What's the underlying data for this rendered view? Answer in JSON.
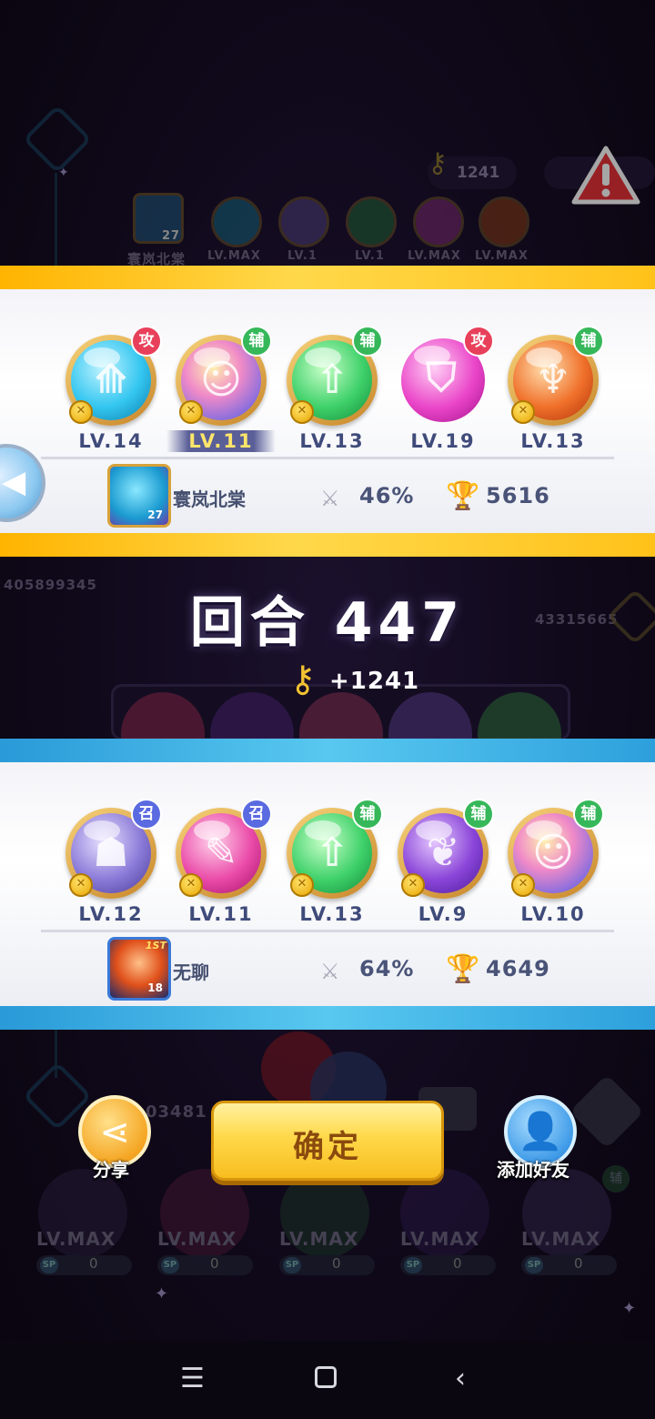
{
  "background": {
    "top_key_count": "1241",
    "top_hero_levels": [
      "27",
      "LV.MAX",
      "LV.1",
      "LV.1",
      "LV.MAX",
      "LV.MAX"
    ],
    "top_player_name": "寰岚北棠",
    "score_left": "405899345",
    "score_right": "43315665",
    "score_bottom": "03481",
    "bottom_levels": [
      "LV.MAX",
      "LV.MAX",
      "LV.MAX",
      "LV.MAX",
      "LV.MAX"
    ],
    "sp_label": "SP",
    "sp_values": [
      "0",
      "0",
      "0",
      "0",
      "0"
    ],
    "role_badge": "辅"
  },
  "top_panel": {
    "heroes": [
      {
        "level": "LV.14",
        "role": "攻",
        "role_type": "atk",
        "color": "#33c6f0"
      },
      {
        "level": "LV.11",
        "role": "辅",
        "role_type": "sup",
        "color": "#c58cf0",
        "mvp": true
      },
      {
        "level": "LV.13",
        "role": "辅",
        "role_type": "sup",
        "color": "#3fd16a"
      },
      {
        "level": "LV.19",
        "role": "攻",
        "role_type": "atk",
        "color": "#ea45c8"
      },
      {
        "level": "LV.13",
        "role": "辅",
        "role_type": "sup",
        "color": "#f0702a"
      }
    ],
    "player": {
      "name": "寰岚北棠",
      "avatar_level": "27",
      "win_rate": "46%",
      "trophies": "5616"
    }
  },
  "round": {
    "label": "回合 447",
    "key_reward": "+1241"
  },
  "bottom_panel": {
    "heroes": [
      {
        "level": "LV.12",
        "role": "召",
        "role_type": "sum",
        "color": "#8a7ad8"
      },
      {
        "level": "LV.11",
        "role": "召",
        "role_type": "sum",
        "color": "#ea4aa8"
      },
      {
        "level": "LV.13",
        "role": "辅",
        "role_type": "sup",
        "color": "#3fd16a"
      },
      {
        "level": "LV.9",
        "role": "辅",
        "role_type": "sup",
        "color": "#8a45d8"
      },
      {
        "level": "LV.10",
        "role": "辅",
        "role_type": "sup",
        "color": "#c58cf0"
      }
    ],
    "player": {
      "name": "无聊",
      "avatar_level": "18",
      "avatar_rank": "1ST",
      "win_rate": "64%",
      "trophies": "4649"
    }
  },
  "buttons": {
    "share": "分享",
    "confirm": "确定",
    "add_friend": "添加好友"
  },
  "navbar": {
    "menu_icon": "menu-icon",
    "home_icon": "home-square-icon",
    "back_icon": "back-chevron-icon"
  }
}
